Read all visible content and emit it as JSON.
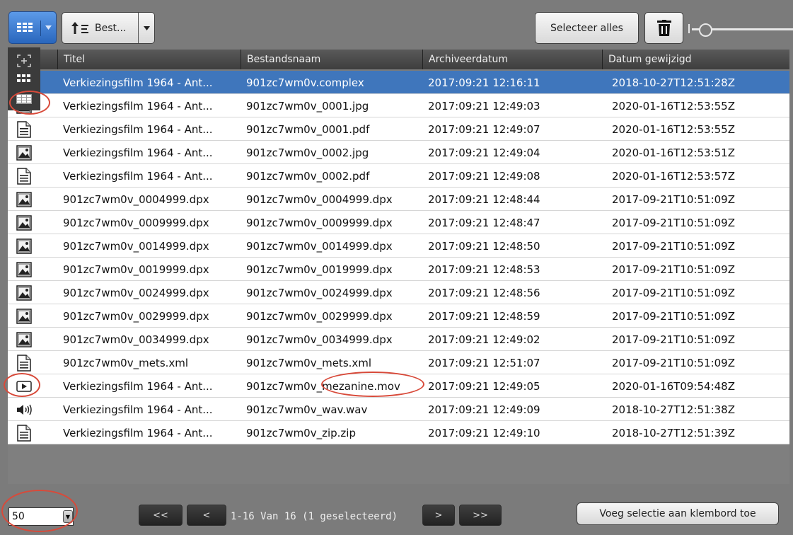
{
  "toolbar": {
    "sort_label": "Best...",
    "select_all_label": "Selecteer alles"
  },
  "columns": {
    "title": "Titel",
    "filename": "Bestandsnaam",
    "archived": "Archiveerdatum",
    "modified": "Datum gewijzigd"
  },
  "rows": [
    {
      "icon": "complex-object-icon",
      "title": "Verkiezingsfilm 1964 - Ant...",
      "filename": "901zc7wm0v.complex",
      "archived": "2017:09:21 12:16:11",
      "modified": "2018-10-27T12:51:28Z",
      "selected": true
    },
    {
      "icon": "image-file-icon",
      "title": "Verkiezingsfilm 1964 - Ant...",
      "filename": "901zc7wm0v_0001.jpg",
      "archived": "2017:09:21 12:49:03",
      "modified": "2020-01-16T12:53:55Z"
    },
    {
      "icon": "document-file-icon",
      "title": "Verkiezingsfilm 1964 - Ant...",
      "filename": "901zc7wm0v_0001.pdf",
      "archived": "2017:09:21 12:49:07",
      "modified": "2020-01-16T12:53:55Z"
    },
    {
      "icon": "image-file-icon",
      "title": "Verkiezingsfilm 1964 - Ant...",
      "filename": "901zc7wm0v_0002.jpg",
      "archived": "2017:09:21 12:49:04",
      "modified": "2020-01-16T12:53:51Z"
    },
    {
      "icon": "document-file-icon",
      "title": "Verkiezingsfilm 1964 - Ant...",
      "filename": "901zc7wm0v_0002.pdf",
      "archived": "2017:09:21 12:49:08",
      "modified": "2020-01-16T12:53:57Z"
    },
    {
      "icon": "image-file-icon",
      "title": "901zc7wm0v_0004999.dpx",
      "filename": "901zc7wm0v_0004999.dpx",
      "archived": "2017:09:21 12:48:44",
      "modified": "2017-09-21T10:51:09Z"
    },
    {
      "icon": "image-file-icon",
      "title": "901zc7wm0v_0009999.dpx",
      "filename": "901zc7wm0v_0009999.dpx",
      "archived": "2017:09:21 12:48:47",
      "modified": "2017-09-21T10:51:09Z"
    },
    {
      "icon": "image-file-icon",
      "title": "901zc7wm0v_0014999.dpx",
      "filename": "901zc7wm0v_0014999.dpx",
      "archived": "2017:09:21 12:48:50",
      "modified": "2017-09-21T10:51:09Z"
    },
    {
      "icon": "image-file-icon",
      "title": "901zc7wm0v_0019999.dpx",
      "filename": "901zc7wm0v_0019999.dpx",
      "archived": "2017:09:21 12:48:53",
      "modified": "2017-09-21T10:51:09Z"
    },
    {
      "icon": "image-file-icon",
      "title": "901zc7wm0v_0024999.dpx",
      "filename": "901zc7wm0v_0024999.dpx",
      "archived": "2017:09:21 12:48:56",
      "modified": "2017-09-21T10:51:09Z"
    },
    {
      "icon": "image-file-icon",
      "title": "901zc7wm0v_0029999.dpx",
      "filename": "901zc7wm0v_0029999.dpx",
      "archived": "2017:09:21 12:48:59",
      "modified": "2017-09-21T10:51:09Z"
    },
    {
      "icon": "image-file-icon",
      "title": "901zc7wm0v_0034999.dpx",
      "filename": "901zc7wm0v_0034999.dpx",
      "archived": "2017:09:21 12:49:02",
      "modified": "2017-09-21T10:51:09Z"
    },
    {
      "icon": "document-file-icon",
      "title": "901zc7wm0v_mets.xml",
      "filename": "901zc7wm0v_mets.xml",
      "archived": "2017:09:21 12:51:07",
      "modified": "2017-09-21T10:51:09Z"
    },
    {
      "icon": "video-file-icon",
      "title": "Verkiezingsfilm 1964 - Ant...",
      "filename": "901zc7wm0v_mezanine.mov",
      "archived": "2017:09:21 12:49:05",
      "modified": "2020-01-16T09:54:48Z"
    },
    {
      "icon": "audio-file-icon",
      "title": "Verkiezingsfilm 1964 - Ant...",
      "filename": "901zc7wm0v_wav.wav",
      "archived": "2017:09:21 12:49:09",
      "modified": "2018-10-27T12:51:38Z"
    },
    {
      "icon": "document-file-icon",
      "title": "Verkiezingsfilm 1964 - Ant...",
      "filename": "901zc7wm0v_zip.zip",
      "archived": "2017:09:21 12:49:10",
      "modified": "2018-10-27T12:51:39Z"
    }
  ],
  "footer": {
    "page_size": "50",
    "first_label": "<<",
    "prev_label": "<",
    "page_info": "1-16 Van 16 (1 geselecteerd)",
    "next_label": ">",
    "last_label": ">>",
    "clipboard_label": "Voeg selectie aan klembord toe"
  },
  "colors": {
    "selected_row": "#3f76bc",
    "toolbar_bg": "#7b7b7b",
    "annotation": "#d84a3a"
  }
}
